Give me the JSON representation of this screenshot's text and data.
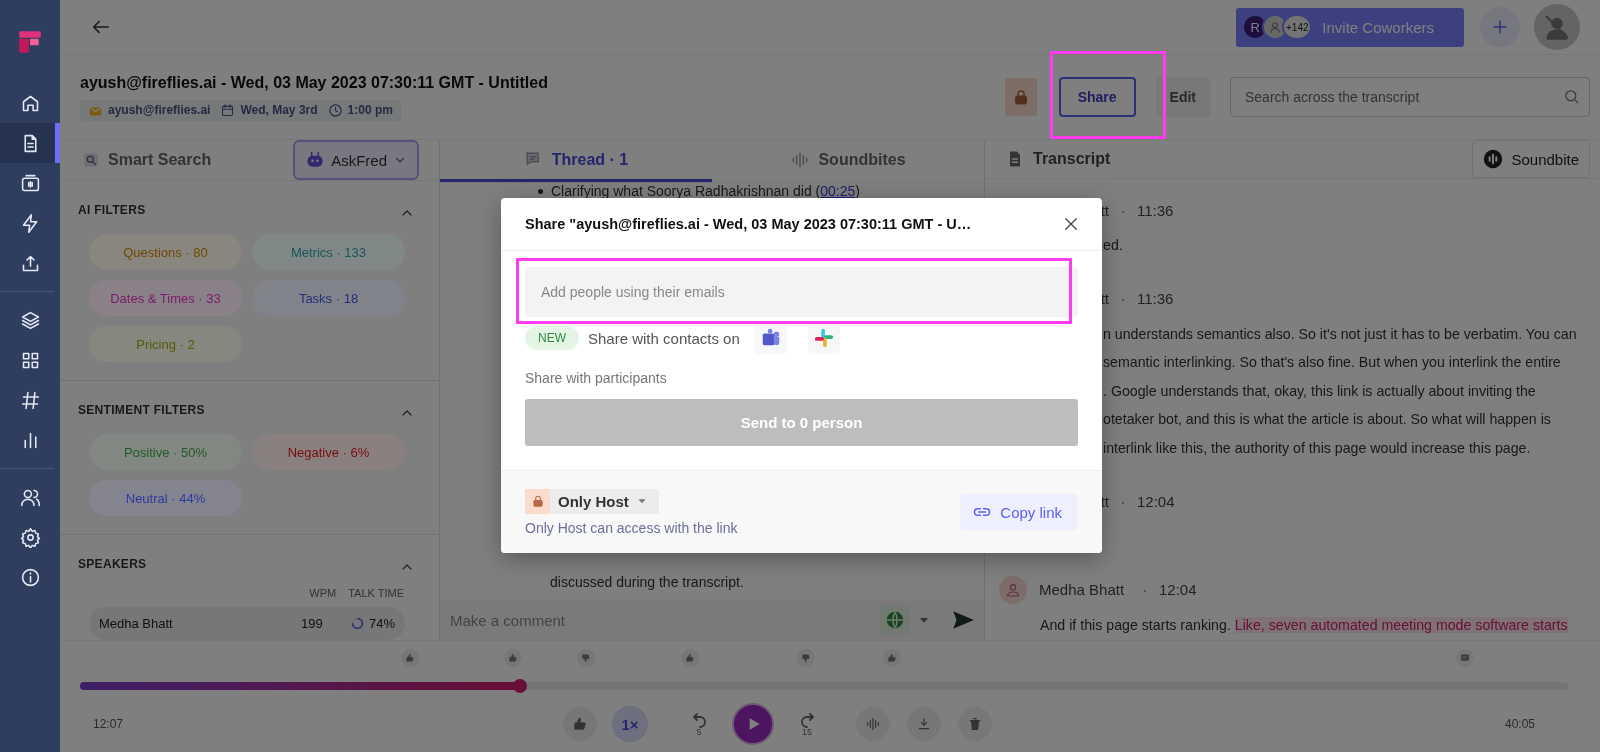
{
  "sidebar": {
    "nav_groups": [
      [
        {
          "kind": "home",
          "selected": false
        },
        {
          "kind": "document",
          "selected": true
        },
        {
          "kind": "recorder",
          "selected": false
        },
        {
          "kind": "bolt",
          "selected": false
        },
        {
          "kind": "upload",
          "selected": false
        }
      ],
      [
        {
          "kind": "layers",
          "selected": false
        },
        {
          "kind": "grid",
          "selected": false
        },
        {
          "kind": "hash",
          "selected": false
        },
        {
          "kind": "chart",
          "selected": false
        }
      ],
      [
        {
          "kind": "people",
          "selected": false
        },
        {
          "kind": "gear",
          "selected": false
        },
        {
          "kind": "info",
          "selected": false
        }
      ]
    ]
  },
  "top_bar": {
    "invite": {
      "initial": "R",
      "count": "+142",
      "label": "Invite Coworkers"
    }
  },
  "meeting": {
    "title": "ayush@fireflies.ai - Wed, 03 May 2023 07:30:11 GMT - Untitled",
    "organizer": "ayush@fireflies.ai",
    "date": "Wed, May 3rd",
    "time": "1:00 pm",
    "share": "Share",
    "edit": "Edit",
    "search_placeholder": "Search across the transcript"
  },
  "left_panel": {
    "title": "Smart Search",
    "assistant": "AskFred",
    "sections": [
      {
        "title": "AI FILTERS",
        "expanded": true,
        "chips": [
          {
            "label": "Questions · 80",
            "color": "#6e4a00"
          },
          {
            "label": "Metrics · 133",
            "color": "#165858"
          },
          {
            "label": "Dates & Times · 33",
            "color": "#7c1a68"
          },
          {
            "label": "Tasks · 18",
            "color": "#22307a"
          },
          {
            "label": "Pricing · 2",
            "color": "#545a08"
          }
        ]
      },
      {
        "title": "SENTIMENT FILTERS",
        "expanded": true,
        "chips": [
          {
            "label": "Positive · 50%",
            "color": "#215a26"
          },
          {
            "label": "Negative · 6%",
            "color": "#7a0c0c"
          },
          {
            "label": "Neutral · 44%",
            "color": "#2f3aa0"
          }
        ]
      }
    ],
    "speakers": {
      "title": "SPEAKERS",
      "expanded": true,
      "columns": [
        "WPM",
        "TALK TIME"
      ],
      "rows": [
        {
          "name": "Medha Bhatt",
          "wpm": "199",
          "talk_time": "74%",
          "level": 0.74
        }
      ]
    }
  },
  "thread_panel": {
    "tabs": [
      {
        "label": "Thread · 1",
        "kind": "thread",
        "selected": true
      },
      {
        "label": "Soundbites",
        "kind": "soundbites",
        "selected": false
      }
    ],
    "bullet": {
      "text": "Clarifying what Soorya Radhakrishnan did (",
      "link": "00:25",
      "end": ")"
    },
    "closing_text": "discussed during the transcript.",
    "comment_placeholder": "Make a comment"
  },
  "transcript": {
    "title": "Transcript",
    "soundbite_button": "Soundbite",
    "entries": [
      {
        "kind": "clipped",
        "speaker": "tt",
        "time": "11:36",
        "lines": [
          "ed."
        ]
      },
      {
        "kind": "clipped",
        "speaker": "tt",
        "time": "11:36",
        "lines": [
          "n understands semantics also. So it's not just it has to be verbatim. You can",
          "semantic interlinking. So that's also fine. But when you interlink the entire",
          ". Google understands that, okay, this link is actually about inviting the",
          "otetaker bot, and this is what the article is about. So what will happen is",
          "interlink like this, the authority of this page would increase this page."
        ]
      },
      {
        "kind": "clipped",
        "speaker": "tt",
        "time": "12:04"
      },
      {
        "kind": "full",
        "speaker": "Medha Bhatt",
        "time": "12:04",
        "lines": [
          "And if this page starts ranking. "
        ],
        "highlight": "Like, seven automated meeting mode software starts"
      }
    ]
  },
  "player": {
    "markers": [
      {
        "kind": "like"
      },
      {
        "kind": "like"
      },
      {
        "kind": "dislike"
      },
      {
        "kind": "like"
      },
      {
        "kind": "dislike"
      },
      {
        "kind": "like"
      },
      {
        "kind": "comment"
      }
    ],
    "level": 0.296,
    "current": "12:07",
    "total": "40:05",
    "speed": "1×",
    "rewind": "5",
    "forward": "15"
  },
  "share_dialog": {
    "title": "Share \"ayush@fireflies.ai - Wed, 03 May 2023 07:30:11 GMT - U…",
    "email_placeholder": "Add people using their emails",
    "new_badge": "NEW",
    "contacts_label": "Share with contacts on",
    "participants_label": "Share with participants",
    "send_button": {
      "label": "Send to 0 person",
      "disabled": true
    },
    "access": {
      "label": "Only Host",
      "caption": "Only Host can access with the link"
    },
    "copy_link": "Copy link"
  }
}
